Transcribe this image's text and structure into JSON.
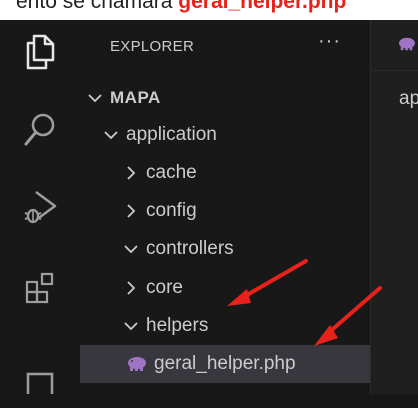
{
  "caption": {
    "prefix": "ento se chamará ",
    "filename": "geral_helper.php"
  },
  "colors": {
    "accent_red": "#e8221b",
    "sidebar_bg": "#181818",
    "selected_bg": "#37373d",
    "php_icon": "#a074c4"
  },
  "activity_bar": {
    "icons": [
      "files-icon",
      "search-icon",
      "run-debug-icon",
      "extensions-icon",
      "remote-explorer-icon"
    ]
  },
  "explorer": {
    "title": "EXPLORER",
    "more_label": "···",
    "tree": [
      {
        "label": "MAPA",
        "expanded": true
      },
      {
        "label": "application",
        "expanded": true
      },
      {
        "label": "cache",
        "expanded": false
      },
      {
        "label": "config",
        "expanded": false
      },
      {
        "label": "controllers",
        "expanded": true
      },
      {
        "label": "core",
        "expanded": false
      },
      {
        "label": "helpers",
        "expanded": true
      },
      {
        "label": "geral_helper.php",
        "type": "php-file",
        "selected": true
      }
    ]
  },
  "editor": {
    "partial_text": "ap"
  }
}
